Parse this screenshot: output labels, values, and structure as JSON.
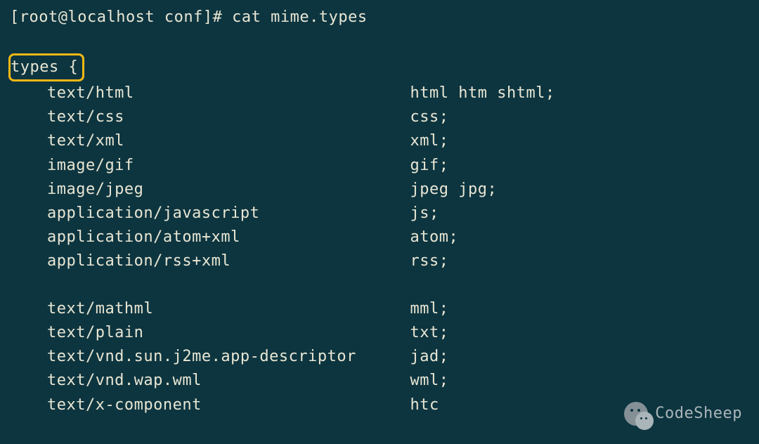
{
  "prompt": "[root@localhost conf]# cat mime.types",
  "types_open": "types {",
  "entries_group1": [
    {
      "mime": "text/html",
      "exts": "html htm shtml;"
    },
    {
      "mime": "text/css",
      "exts": "css;"
    },
    {
      "mime": "text/xml",
      "exts": "xml;"
    },
    {
      "mime": "image/gif",
      "exts": "gif;"
    },
    {
      "mime": "image/jpeg",
      "exts": "jpeg jpg;"
    },
    {
      "mime": "application/javascript",
      "exts": "js;"
    },
    {
      "mime": "application/atom+xml",
      "exts": "atom;"
    },
    {
      "mime": "application/rss+xml",
      "exts": "rss;"
    }
  ],
  "entries_group2": [
    {
      "mime": "text/mathml",
      "exts": "mml;"
    },
    {
      "mime": "text/plain",
      "exts": "txt;"
    },
    {
      "mime": "text/vnd.sun.j2me.app-descriptor",
      "exts": "jad;"
    },
    {
      "mime": "text/vnd.wap.wml",
      "exts": "wml;"
    },
    {
      "mime": "text/x-component",
      "exts": "htc"
    }
  ],
  "watermark": "CodeSheep"
}
